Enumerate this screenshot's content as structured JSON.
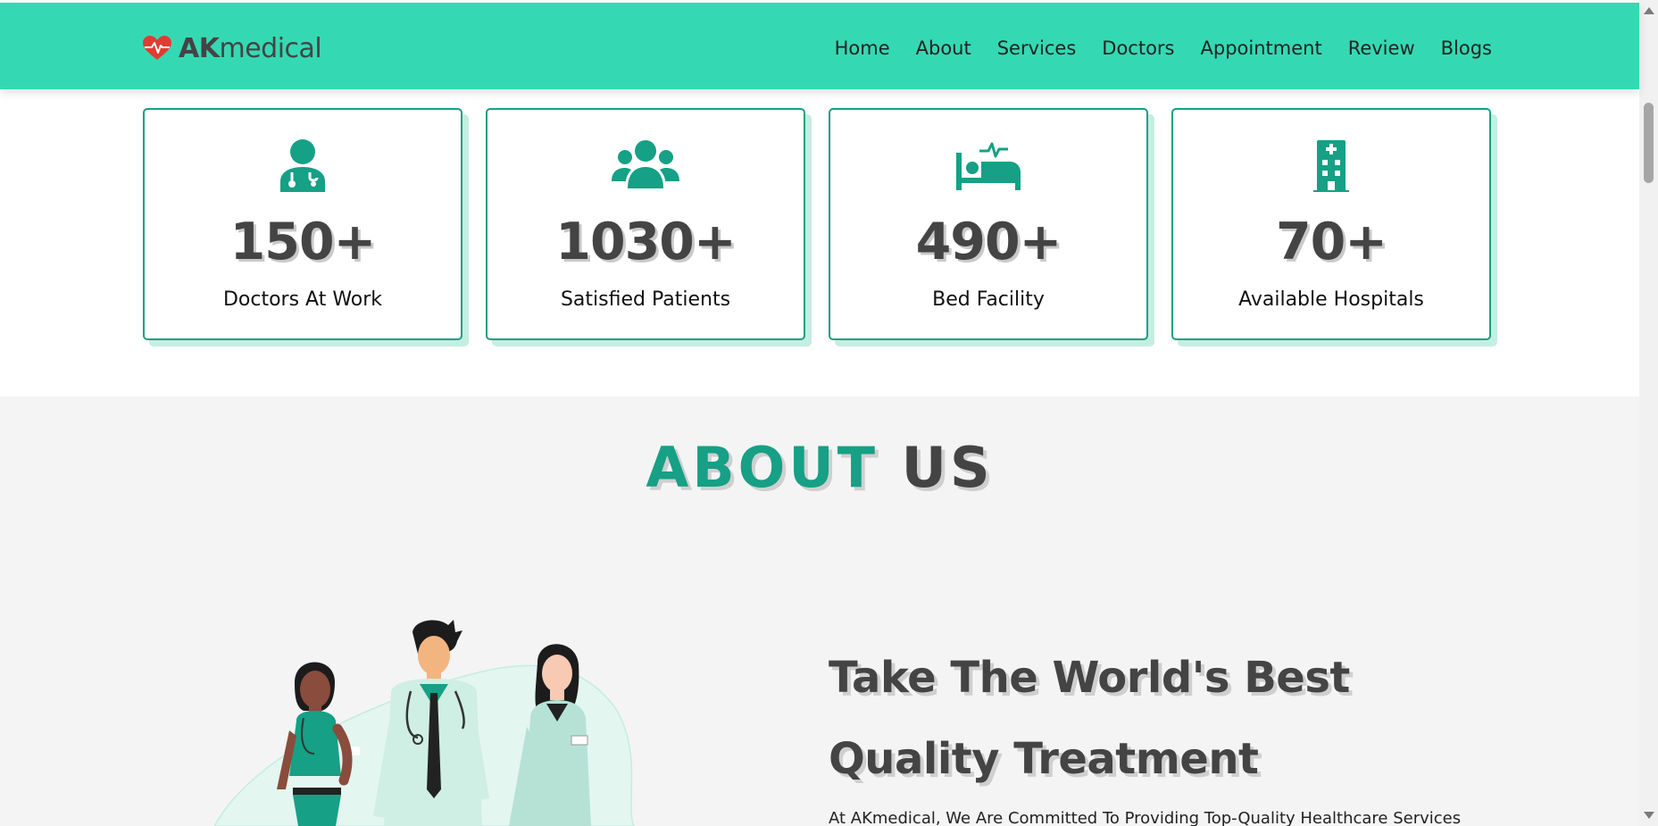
{
  "brand": {
    "name_bold": "AK",
    "name_rest": "medical",
    "heart_color": "#e03c31"
  },
  "colors": {
    "header_bg": "#34d9b3",
    "accent": "#16a085",
    "dark_text": "#444444",
    "card_shadow": "#c4eee2"
  },
  "nav": {
    "items": [
      {
        "label": "Home"
      },
      {
        "label": "About"
      },
      {
        "label": "Services"
      },
      {
        "label": "Doctors"
      },
      {
        "label": "Appointment"
      },
      {
        "label": "Review"
      },
      {
        "label": "Blogs"
      }
    ]
  },
  "stats": [
    {
      "icon": "doctor-icon",
      "value": "150+",
      "label": "Doctors At Work"
    },
    {
      "icon": "users-icon",
      "value": "1030+",
      "label": "Satisfied Patients"
    },
    {
      "icon": "bed-icon",
      "value": "490+",
      "label": "Bed Facility"
    },
    {
      "icon": "hospital-icon",
      "value": "70+",
      "label": "Available Hospitals"
    }
  ],
  "about": {
    "heading_accent": "ABOUT",
    "heading_rest": "US",
    "title_line1": "Take The World's Best",
    "title_line2": "Quality Treatment",
    "text": "At AKmedical, We Are Committed To Providing Top-Quality Healthcare Services"
  }
}
